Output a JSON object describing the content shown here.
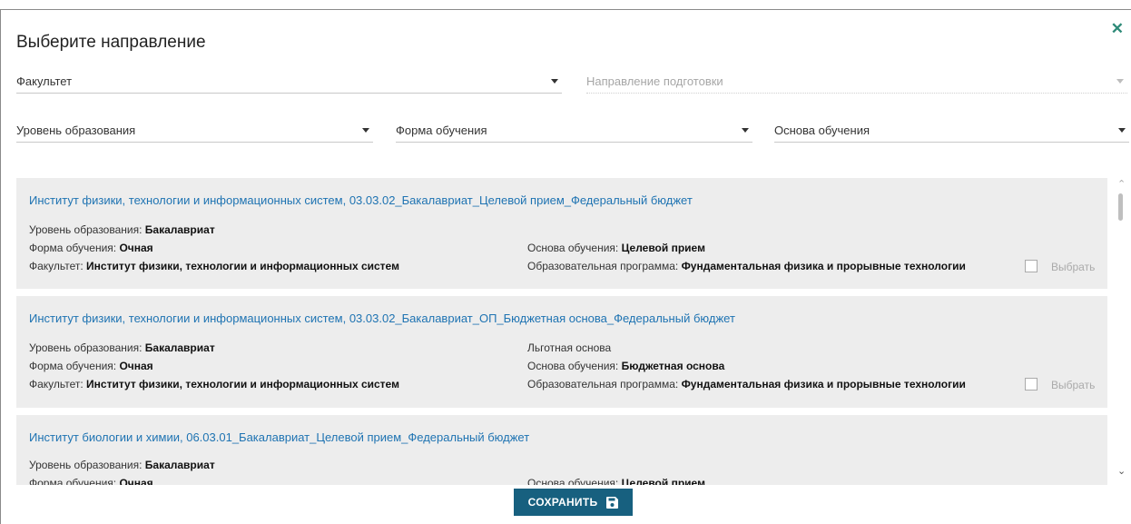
{
  "dialog": {
    "title": "Выберите направление",
    "close_icon": "close-icon"
  },
  "filters": {
    "faculty": "Факультет",
    "direction": "Направление подготовки",
    "level": "Уровень образования",
    "form": "Форма обучения",
    "basis": "Основа обучения"
  },
  "labels": {
    "level": "Уровень образования:",
    "form": "Форма обучения:",
    "faculty": "Факультет:",
    "basis": "Основа обучения:",
    "program": "Образовательная программа:",
    "select": "Выбрать"
  },
  "items": [
    {
      "title": "Институт физики, технологии и информационных систем, 03.03.02_Бакалавриат_Целевой прием_Федеральный бюджет",
      "level": "Бакалавриат",
      "form": "Очная",
      "faculty": "Институт физики, технологии и информационных систем",
      "basis": "Целевой прием",
      "program": "Фундаментальная физика и прорывные технологии"
    },
    {
      "title": "Институт физики, технологии и информационных систем, 03.03.02_Бакалавриат_ОП_Бюджетная основа_Федеральный бюджет",
      "level": "Бакалавриат",
      "form": "Очная",
      "faculty": "Институт физики, технологии и информационных систем",
      "extra": "Льготная основа",
      "basis": "Бюджетная основа",
      "program": "Фундаментальная физика и прорывные технологии"
    },
    {
      "title": "Институт биологии и химии, 06.03.01_Бакалавриат_Целевой прием_Федеральный бюджет",
      "level": "Бакалавриат",
      "form": "Очная",
      "basis": "Целевой прием"
    }
  ],
  "save": {
    "label": "СОХРАНИТЬ",
    "icon": "floppy-disk-icon"
  },
  "colors": {
    "link": "#1e73b2",
    "accent": "#2e8a78",
    "button": "#17607f"
  }
}
